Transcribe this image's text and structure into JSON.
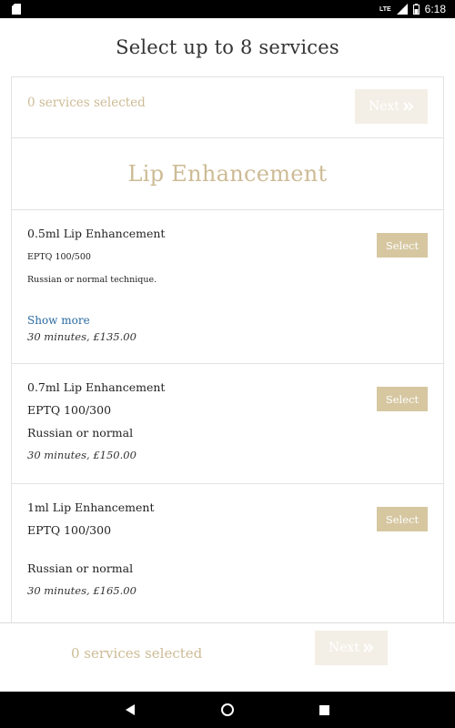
{
  "status_bar": {
    "network": "LTE",
    "time": "6:18"
  },
  "page_title": "Select up to 8 services",
  "top_bar": {
    "count_text": "0 services selected",
    "next_label": "Next"
  },
  "section_title": "Lip Enhancement",
  "services": [
    {
      "name": "0.5ml Lip Enhancement",
      "line1": "EPTQ 100/500",
      "line2": "Russian or normal technique.",
      "show_more": "Show more",
      "meta": "30 minutes, £135.00",
      "select_label": "Select"
    },
    {
      "name": "0.7ml Lip Enhancement",
      "line1": "EPTQ 100/300",
      "line2": "Russian or normal",
      "meta": "30 minutes, £150.00",
      "select_label": "Select"
    },
    {
      "name": "1ml Lip Enhancement",
      "line1": "EPTQ 100/300",
      "line2": "Russian or normal",
      "meta": "30 minutes, £165.00",
      "select_label": "Select"
    }
  ],
  "bottom_bar": {
    "count_text": "0 services selected",
    "next_label": "Next"
  },
  "colors": {
    "accent": "#cdbb95",
    "button": "#d6c7a1",
    "disabled_button": "#f4efe6",
    "link": "#2a6aa1"
  },
  "icons": [
    "sd-card-icon",
    "signal-icon",
    "battery-icon",
    "chevrons-right-icon",
    "back-icon",
    "home-icon",
    "recents-icon"
  ]
}
